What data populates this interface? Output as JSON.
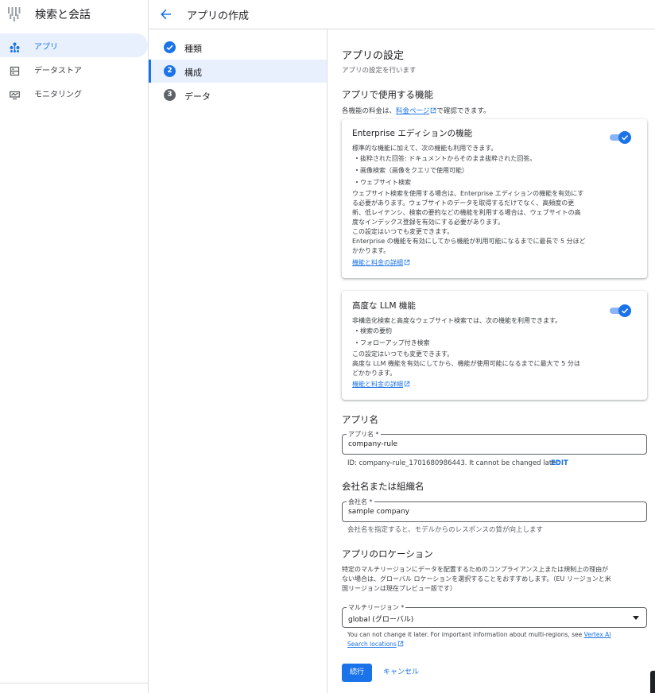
{
  "sidebar": {
    "product_title": "検索と会話",
    "items": [
      {
        "label": "アプリ",
        "icon": "apps-icon",
        "active": true
      },
      {
        "label": "データストア",
        "icon": "datastore-icon",
        "active": false
      },
      {
        "label": "モニタリング",
        "icon": "monitoring-icon",
        "active": false
      }
    ]
  },
  "header": {
    "title": "アプリの作成"
  },
  "stepper": {
    "steps": [
      {
        "number": "",
        "label": "種類",
        "state": "done"
      },
      {
        "number": "2",
        "label": "構成",
        "state": "active"
      },
      {
        "number": "3",
        "label": "データ",
        "state": "pending"
      }
    ]
  },
  "main": {
    "title": "アプリの設定",
    "subtitle": "アプリの設定を行います",
    "features": {
      "heading": "アプリで使用する機能",
      "pricing_prefix": "各機能の料金は、",
      "pricing_link": "料金ページ",
      "pricing_suffix": "で確認できます。"
    },
    "enterprise": {
      "title": "Enterprise エディションの機能",
      "enabled": true,
      "intro": "標準的な機能に加えて、次の機能も利用できます。",
      "bullets": [
        "抜粋された回答: ドキュメントからそのまま抜粋された回答。",
        "画像検索（画像をクエリで使用可能）",
        "ウェブサイト検索"
      ],
      "lines": [
        "ウェブサイト検索を使用する場合は、Enterprise エディションの機能を有効にす",
        "る必要があります。ウェブサイトのデータを取得するだけでなく、高頻度の更",
        "新、低レイテンシ、検索の要約などの機能を利用する場合は、ウェブサイトの高",
        "度なインデックス登録を有効にする必要があります。",
        "この設定はいつでも変更できます。",
        "Enterprise の機能を有効にしてから機能が利用可能になるまでに最長で 5 分ほど",
        "かかります。"
      ],
      "link": "機能と料金の詳細"
    },
    "llm": {
      "title": "高度な LLM 機能",
      "enabled": true,
      "intro": "非構造化検索と高度なウェブサイト検索では、次の機能を利用できます。",
      "bullets": [
        "検索の要約",
        "フォローアップ付き検索"
      ],
      "lines": [
        "この設定はいつでも変更できます。",
        "高度な LLM 機能を有効にしてから、機能が使用可能になるまでに最大で 5 分ほ",
        "どかかります。"
      ],
      "link": "機能と料金の詳細"
    },
    "app_name": {
      "heading": "アプリ名",
      "label": "アプリ名 *",
      "value": "company-rule",
      "id_text": "ID: company-rule_1701680986443. It cannot be changed later.",
      "edit": "EDIT"
    },
    "company": {
      "heading": "会社名または組織名",
      "label": "会社名 *",
      "value": "sample company",
      "hint": "会社名を指定すると、モデルからのレスポンスの質が向上します"
    },
    "location": {
      "heading": "アプリのロケーション",
      "desc": [
        "特定のマルチリージョンにデータを配置するためのコンプライアンス上または規制上の理由が",
        "ない場合は、グローバル ロケーションを選択することをおすすめします。（EU リージョンと米",
        "国リージョンは現在プレビュー版です）"
      ],
      "label": "マルチリージョン *",
      "value": "global (グローバル)",
      "hint_prefix": "You can not change it later. For important information about multi-regions, see ",
      "hint_link_1": "Vertex AI",
      "hint_link_2": "Search locations"
    },
    "actions": {
      "continue": "続行",
      "cancel": "キャンセル"
    }
  },
  "colors": {
    "accent": "#1a73e8",
    "active_bg": "#e8f0fe",
    "done": "#1a73e8",
    "pending": "#5f6368"
  }
}
